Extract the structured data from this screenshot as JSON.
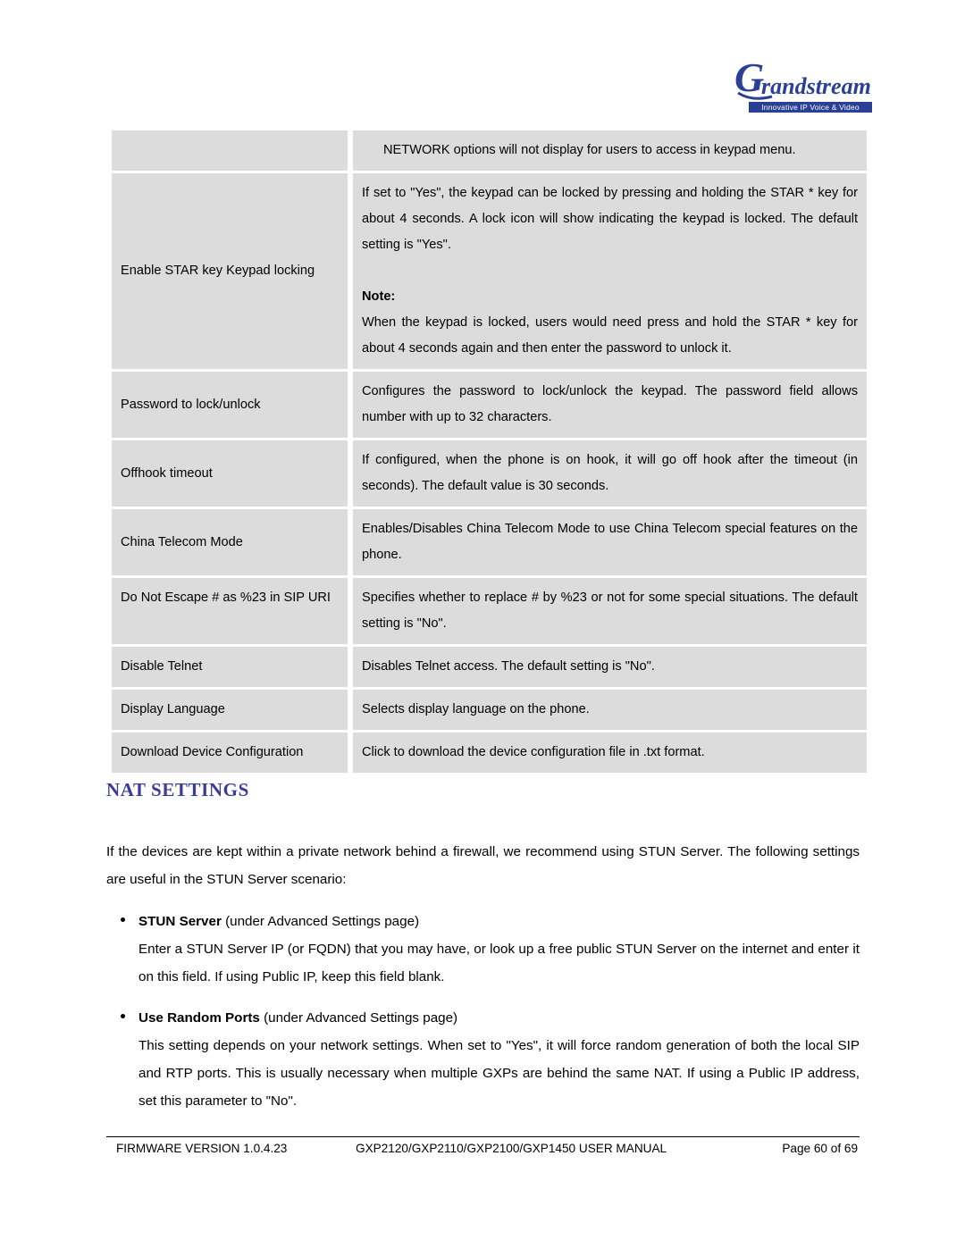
{
  "header": {
    "logo_name": "Grandstream",
    "logo_tagline": "Innovative IP Voice & Video",
    "logo_color": "#2a3f96"
  },
  "table": {
    "rows": [
      {
        "key": "",
        "desc_lines": [
          "NETWORK options will not display for users to access in keypad",
          "menu."
        ],
        "desc": "NETWORK options will not display for users to access in keypad menu."
      },
      {
        "key": "Enable STAR key Keypad locking",
        "desc": "If set to \"Yes\", the keypad can be locked by pressing and holding the STAR * key for about 4 seconds. A lock icon will show indicating the keypad is locked. The default setting is \"Yes\".",
        "note_label": "Note:",
        "note": "When the keypad is locked, users would need press and hold the STAR * key for about 4 seconds again and then enter the password to unlock it."
      },
      {
        "key": "Password to lock/unlock",
        "desc": "Configures the password to lock/unlock the keypad. The password field allows number with up to 32 characters."
      },
      {
        "key": "Offhook timeout",
        "desc": "If configured, when the phone is on hook, it will go off hook after the timeout (in seconds). The default value is 30 seconds."
      },
      {
        "key": "China Telecom Mode",
        "desc": "Enables/Disables China Telecom Mode to use China Telecom special features on the phone."
      },
      {
        "key": "Do Not Escape # as %23 in SIP URI",
        "desc": "Specifies whether to replace # by %23 or not for some special situations. The default setting is \"No\"."
      },
      {
        "key": "Disable Telnet",
        "desc": "Disables Telnet access. The default setting is \"No\"."
      },
      {
        "key": "Display Language",
        "desc": "Selects display language on the phone."
      },
      {
        "key": "Download Device Configuration",
        "desc": "Click to download the device configuration file in .txt format."
      }
    ]
  },
  "section": {
    "heading": "NAT SETTINGS",
    "heading_color": "#3b3b9c",
    "intro": "If the devices are kept within a private network behind a firewall, we recommend using STUN Server. The following settings are useful in the STUN Server scenario:",
    "bullets": [
      {
        "term": "STUN Server",
        "term_suffix": " (under Advanced Settings page)",
        "body": "Enter a STUN Server IP (or FQDN) that you may have, or look up a free public STUN Server on the internet and enter it on this field. If using Public IP, keep this field blank."
      },
      {
        "term": "Use Random Ports",
        "term_suffix": " (under Advanced Settings page)",
        "body": "This setting depends on your network settings. When set to \"Yes\", it will force random generation of both the local SIP and RTP ports. This is usually necessary when multiple GXPs are behind the same NAT. If using a Public IP address, set this parameter to \"No\"."
      }
    ]
  },
  "footer": {
    "firmware": "FIRMWARE VERSION 1.0.4.23",
    "manual": "GXP2120/GXP2110/GXP2100/GXP1450 USER MANUAL",
    "page": "Page 60 of 69"
  }
}
